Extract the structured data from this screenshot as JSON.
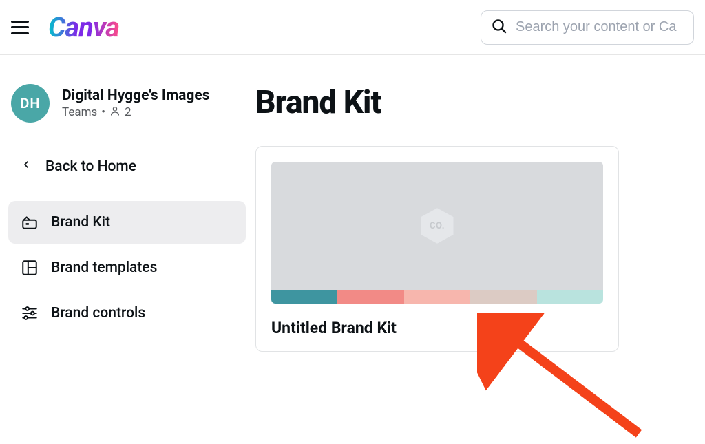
{
  "header": {
    "logo_text": "Canva",
    "search_placeholder": "Search your content or Ca"
  },
  "team": {
    "avatar_initials": "DH",
    "name": "Digital Hygge's Images",
    "type": "Teams",
    "member_count": "2"
  },
  "nav": {
    "back_label": "Back to Home",
    "items": [
      {
        "label": "Brand Kit",
        "active": true
      },
      {
        "label": "Brand templates",
        "active": false
      },
      {
        "label": "Brand controls",
        "active": false
      }
    ]
  },
  "page": {
    "title": "Brand Kit"
  },
  "brand_kit": {
    "name": "Untitled Brand Kit",
    "placeholder_badge": "CO.",
    "colors": [
      "#3e95a0",
      "#f28a86",
      "#f7b6ad",
      "#dccbc4",
      "#b9e3de"
    ]
  }
}
